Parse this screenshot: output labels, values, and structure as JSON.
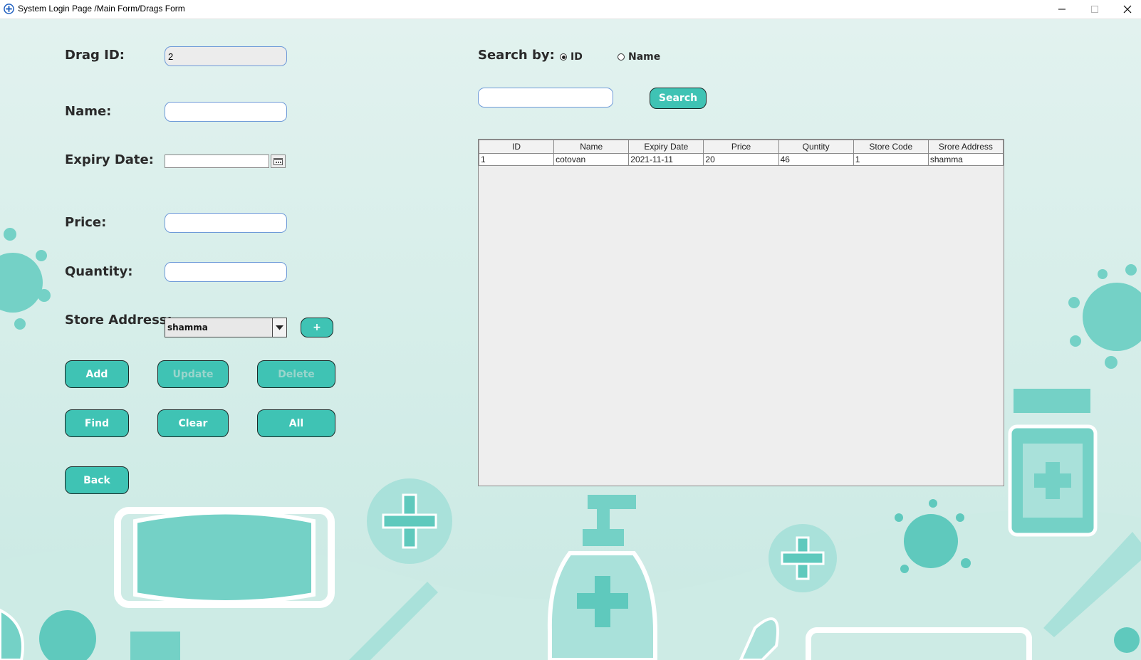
{
  "window": {
    "title": "System Login Page /Main Form/Drags Form"
  },
  "form": {
    "drag_id": {
      "label": "Drag ID:",
      "value": "2"
    },
    "name": {
      "label": "Name:",
      "value": ""
    },
    "expiry_date": {
      "label": "Expiry Date:",
      "value": ""
    },
    "price": {
      "label": "Price:",
      "value": ""
    },
    "quantity": {
      "label": "Quantity:",
      "value": ""
    },
    "store_address": {
      "label": "Store Address:",
      "selected": "shamma",
      "add_label": "+"
    }
  },
  "buttons": {
    "add": "Add",
    "update": "Update",
    "delete": "Delete",
    "find": "Find",
    "clear": "Clear",
    "all": "All",
    "back": "Back"
  },
  "search": {
    "label": "Search by:",
    "option_id": "ID",
    "option_name": "Name",
    "selected": "ID",
    "query": "",
    "button": "Search"
  },
  "table": {
    "columns": [
      "ID",
      "Name",
      "Expiry Date",
      "Price",
      "Quntity",
      "Store Code",
      "Srore Address"
    ],
    "rows": [
      [
        "1",
        "cotovan",
        "2021-11-11",
        "20",
        "46",
        "1",
        "shamma"
      ]
    ]
  },
  "colors": {
    "background": "#dcefeb",
    "accent": "#3fc3b4",
    "decor": "#74d1c6"
  },
  "icons": [
    "app-icon",
    "minimize-icon",
    "maximize-icon",
    "close-icon",
    "calendar-icon",
    "chevron-down-icon"
  ]
}
